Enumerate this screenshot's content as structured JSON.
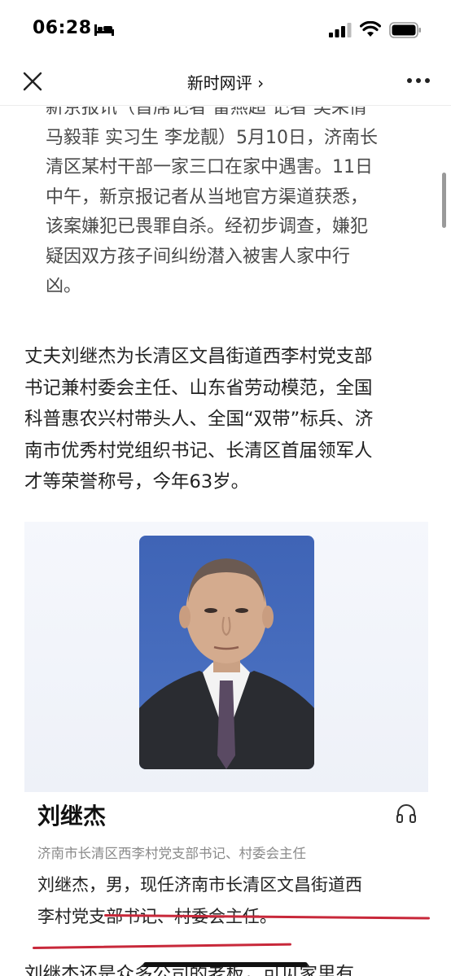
{
  "status_bar": {
    "time": "06:28",
    "icons": [
      "bed-icon",
      "signal-icon",
      "wifi-icon",
      "battery-icon"
    ]
  },
  "nav": {
    "title": "新时网评",
    "chevron": "›",
    "icons": [
      "close-icon",
      "more-icon"
    ]
  },
  "article": {
    "quote_lines": [
      "新京报讯（首席记者 雷燕超 记者 吴采倩",
      "马毅菲 实习生 李龙靓）5月10日，济南长",
      "清区某村干部一家三口在家中遇害。11日",
      "中午，新京报记者从当地官方渠道获悉，",
      "该案嫌犯已畏罪自杀。经初步调查，嫌犯",
      "疑因双方孩子间纠纷潜入被害人家中行",
      "凶。"
    ],
    "paragraph_lines": [
      "丈夫刘继杰为长清区文昌街道西李村党支部",
      "书记兼村委会主任、山东省劳动模范，全国",
      "科普惠农兴村带头人、全国“双带”标兵、济",
      "南市优秀村党组织书记、长清区首届领军人",
      "才等荣誉称号，今年63岁。"
    ],
    "bottom_line": "刘继杰还是众多公司的老板，可见家里有"
  },
  "profile": {
    "name": "刘继杰",
    "title": "济南市长清区西李村党支部书记、村委会主任",
    "bio_lines": [
      "刘继杰，男，现任济南市长清区文昌街道西",
      "李村党支部书记、村委会主任。"
    ],
    "photo": "portrait-photo",
    "headphone": "headphone-icon",
    "underline_color": "#c8283a"
  }
}
